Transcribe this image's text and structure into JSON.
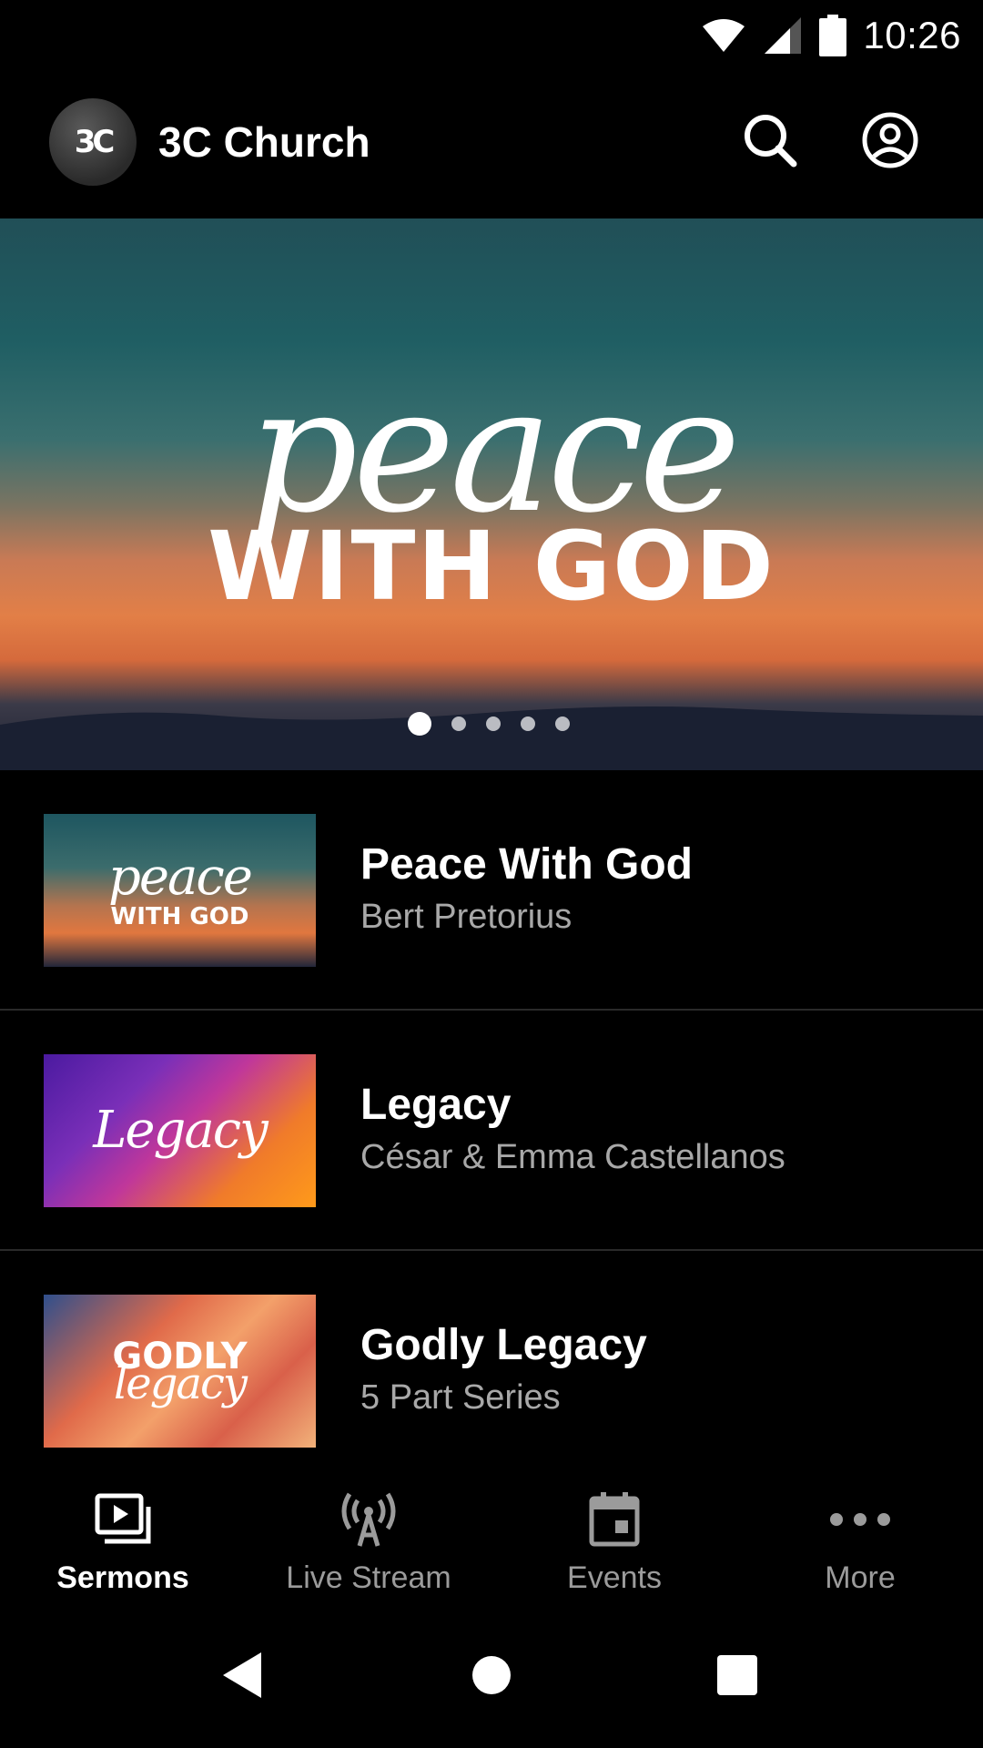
{
  "status_bar": {
    "time": "10:26",
    "icons": [
      "wifi-icon",
      "cell-signal-icon",
      "battery-icon"
    ]
  },
  "app_bar": {
    "logo_text": "3C",
    "title": "3C Church",
    "actions": [
      "search-icon",
      "account-icon"
    ]
  },
  "hero": {
    "script_text": "peace",
    "caps_text": "WITH GOD",
    "carousel": {
      "count": 5,
      "active_index": 0
    }
  },
  "sermons": [
    {
      "title": "Peace With God",
      "subtitle": "Bert Pretorius",
      "thumb_script": "peace",
      "thumb_caps": "WITH GOD"
    },
    {
      "title": "Legacy",
      "subtitle": "César & Emma Castellanos",
      "thumb_script": "Legacy",
      "thumb_caps": ""
    },
    {
      "title": "Godly Legacy",
      "subtitle": "5 Part Series",
      "thumb_script": "legacy",
      "thumb_caps": "GODLY"
    }
  ],
  "bottom_nav": {
    "items": [
      {
        "label": "Sermons",
        "icon": "video-library-icon",
        "active": true
      },
      {
        "label": "Live Stream",
        "icon": "broadcast-tower-icon",
        "active": false
      },
      {
        "label": "Events",
        "icon": "calendar-icon",
        "active": false
      },
      {
        "label": "More",
        "icon": "more-dots-icon",
        "active": false
      }
    ]
  },
  "system_nav": [
    "back-icon",
    "home-icon",
    "recents-icon"
  ],
  "colors": {
    "background": "#000000",
    "text_primary": "#ffffff",
    "text_secondary": "#a8a8a8",
    "nav_inactive": "#9b9b9b",
    "divider": "#2a2a2a"
  }
}
